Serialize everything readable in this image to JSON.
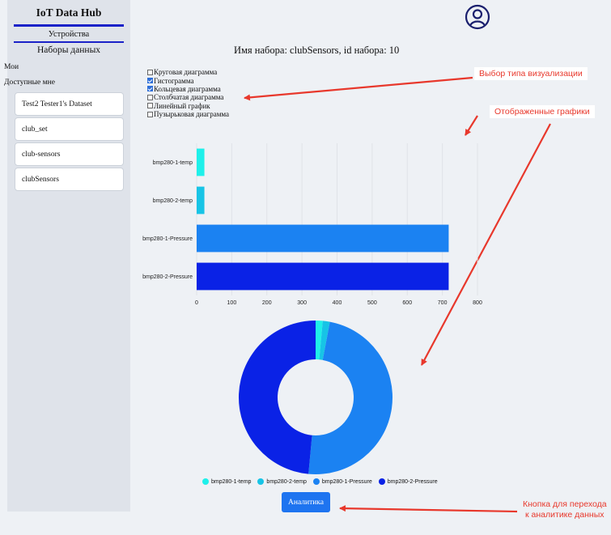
{
  "sidebar": {
    "title": "IoT Data Hub",
    "links": [
      {
        "label": "Устройства"
      },
      {
        "label": "Наборы данных"
      }
    ],
    "section_mine": "Мои",
    "section_available": "Доступные мне",
    "datasets": [
      {
        "label": "Test2 Tester1's Dataset"
      },
      {
        "label": "club_set"
      },
      {
        "label": "club-sensors"
      },
      {
        "label": "clubSensors"
      }
    ]
  },
  "header": {
    "profile_icon": "user-circle-icon"
  },
  "dataset_title": "Имя набора: clubSensors, id набора: 10",
  "chart_types": [
    {
      "label": "Круговая диаграмма",
      "checked": false
    },
    {
      "label": "Гистограмма",
      "checked": true
    },
    {
      "label": "Кольцевая диаграмма",
      "checked": true
    },
    {
      "label": "Столбчатая диаграмма",
      "checked": false
    },
    {
      "label": "Линейный график",
      "checked": false
    },
    {
      "label": "Пузырьковая диаграмма",
      "checked": false
    }
  ],
  "annotations": {
    "viz_type": "Выбор типа визуализации",
    "charts_shown": "Отображенные графики",
    "button_hint_1": "Кнопка для перехода",
    "button_hint_2": "к аналитике данных"
  },
  "colors": {
    "accent": "#1e74f0",
    "annotation": "#e8382c",
    "series": [
      "#1ef0ea",
      "#17c4e6",
      "#1b82f2",
      "#0a22e6"
    ]
  },
  "chart_data": [
    {
      "type": "bar",
      "orientation": "horizontal",
      "categories": [
        "bmp280-1-temp",
        "bmp280-2-temp",
        "bmp280-1-Pressure",
        "bmp280-2-Pressure"
      ],
      "values": [
        22,
        22,
        718,
        718
      ],
      "xlim": [
        0,
        800
      ],
      "xticks": [
        0,
        100,
        200,
        300,
        400,
        500,
        600,
        700,
        800
      ],
      "grid": true
    },
    {
      "type": "pie",
      "variant": "donut",
      "labels": [
        "bmp280-1-temp",
        "bmp280-2-temp",
        "bmp280-1-Pressure",
        "bmp280-2-Pressure"
      ],
      "values": [
        22,
        22,
        718,
        718
      ],
      "legend": "bottom"
    }
  ],
  "button": {
    "label": "Аналитика"
  }
}
